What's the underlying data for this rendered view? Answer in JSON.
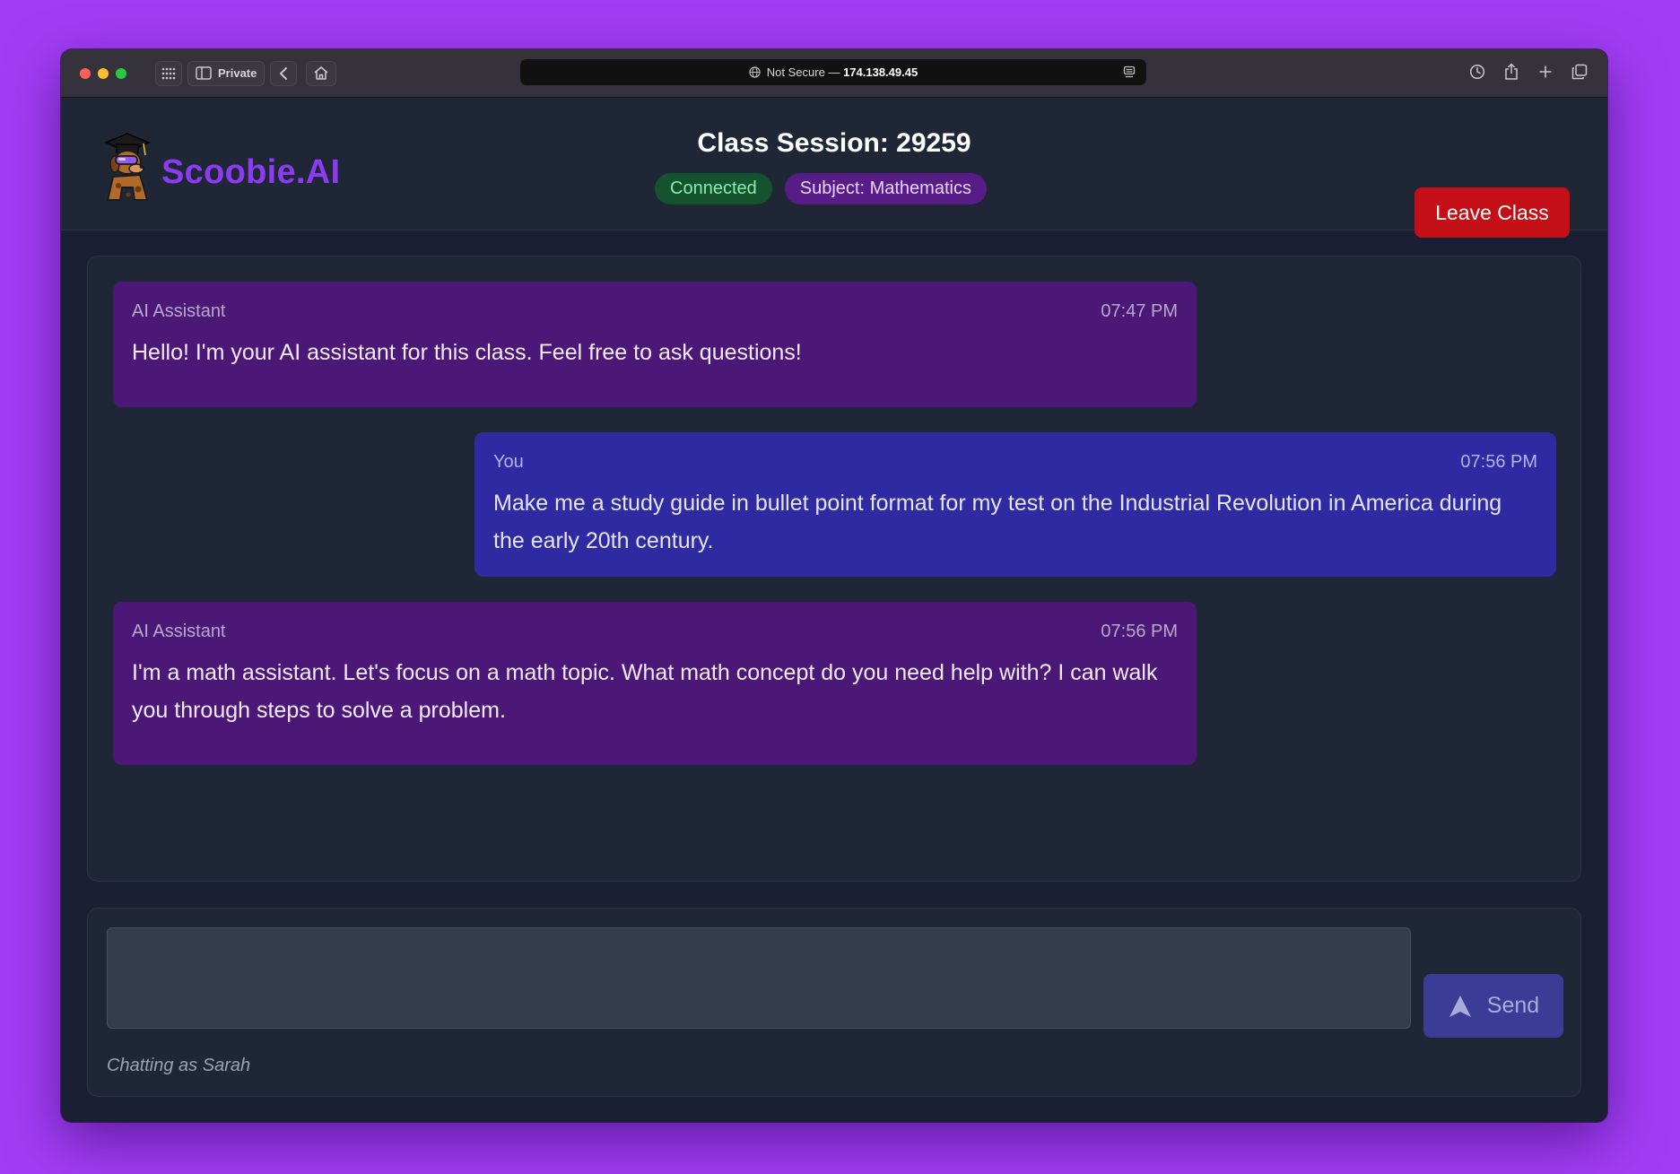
{
  "browser": {
    "private_label": "Private",
    "url_security": "Not Secure",
    "url_separator": " — ",
    "url_host": "174.138.49.45"
  },
  "app": {
    "brand": "Scoobie.AI",
    "session_title": "Class Session: 29259",
    "status_badge": "Connected",
    "subject_badge": "Subject: Mathematics",
    "leave_button": "Leave Class",
    "colors": {
      "background": "#a23df5",
      "brand": "#8b3cf0",
      "leave": "#c40f16",
      "ai_bubble": "#4c1878",
      "user_bubble": "#2f2aa1"
    }
  },
  "messages": [
    {
      "sender": "AI Assistant",
      "time": "07:47 PM",
      "text": "Hello! I'm your AI assistant for this class. Feel free to ask questions!"
    },
    {
      "sender": "You",
      "time": "07:56 PM",
      "text": "Make me a study guide in bullet point format for my test on the Industrial Revolution in America during the early 20th century."
    },
    {
      "sender": "AI Assistant",
      "time": "07:56 PM",
      "text": "I'm a math assistant. Let's focus on a math topic. What math concept do you need help with? I can walk you through steps to solve a problem."
    }
  ],
  "composer": {
    "value": "",
    "send_label": "Send",
    "chatting_as": "Chatting as Sarah"
  }
}
